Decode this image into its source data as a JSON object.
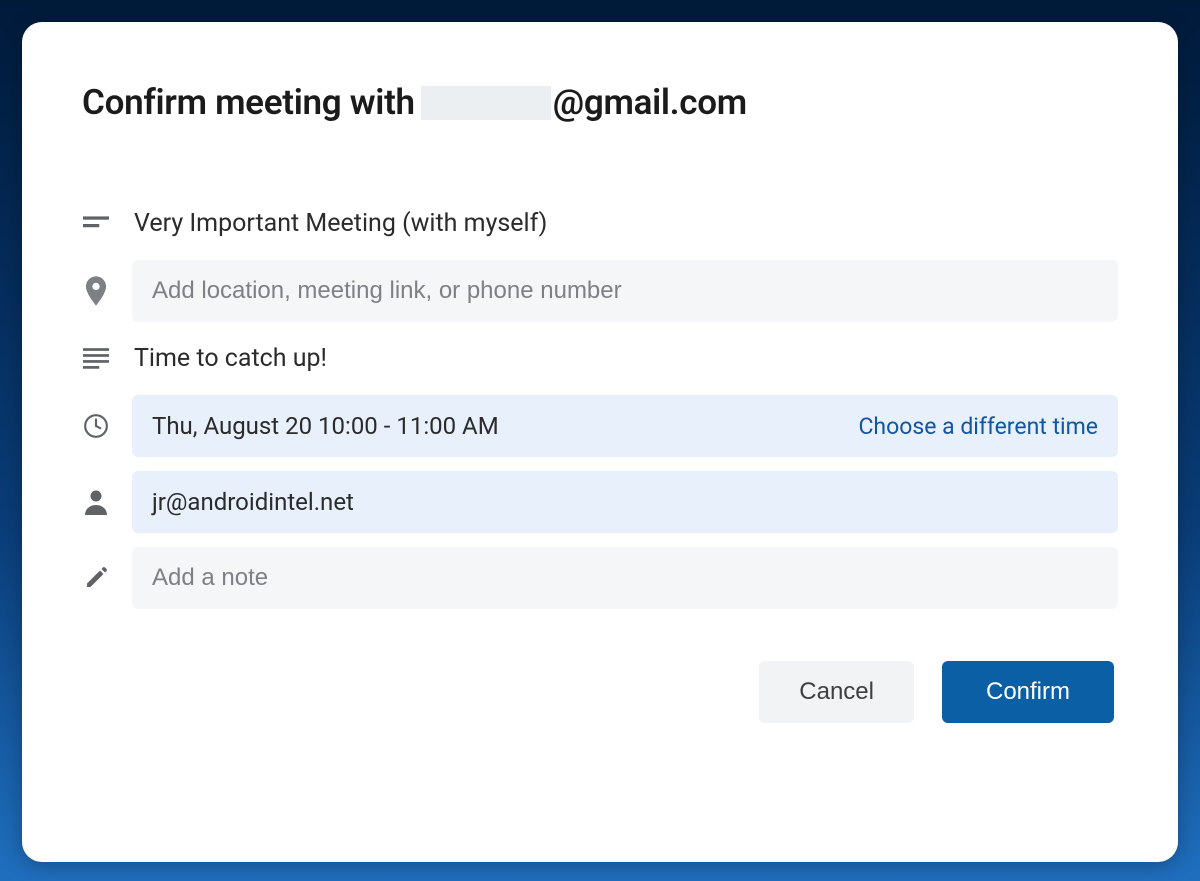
{
  "title_prefix": "Confirm meeting with",
  "title_suffix": "@gmail.com",
  "fields": {
    "subject": "Very Important Meeting (with myself)",
    "location_placeholder": "Add location, meeting link, or phone number",
    "description": "Time to catch up!",
    "time": "Thu, August 20 10:00 - 11:00 AM",
    "choose_time": "Choose a different time",
    "attendee": "jr@androidintel.net",
    "note_placeholder": "Add a note"
  },
  "buttons": {
    "cancel": "Cancel",
    "confirm": "Confirm"
  }
}
